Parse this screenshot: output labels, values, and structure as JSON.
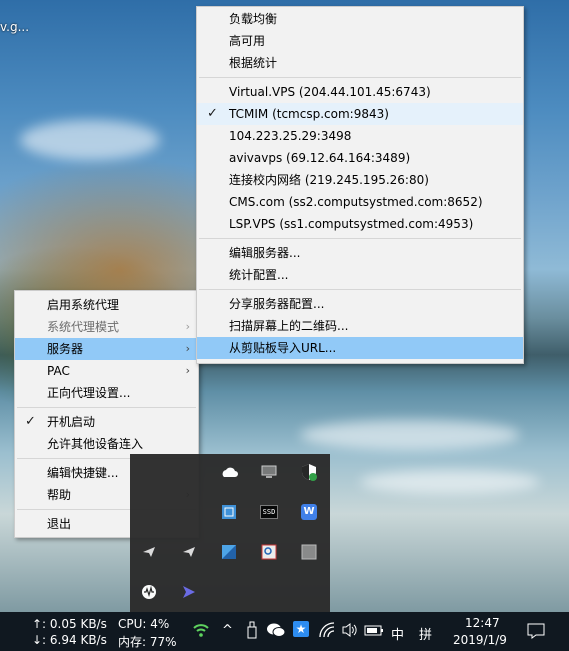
{
  "desktop": {
    "label": "v.g..."
  },
  "main_menu": {
    "items": [
      {
        "label": "启用系统代理",
        "checked": false,
        "submenu": false,
        "disabled": false
      },
      {
        "label": "系统代理模式",
        "checked": false,
        "submenu": true,
        "disabled": true
      },
      {
        "label": "服务器",
        "checked": false,
        "submenu": true,
        "disabled": false,
        "highlighted": true
      },
      {
        "label": "PAC",
        "checked": false,
        "submenu": true,
        "disabled": false
      },
      {
        "label": "正向代理设置...",
        "checked": false,
        "submenu": false,
        "disabled": false
      },
      {
        "label": "开机启动",
        "checked": true,
        "submenu": false,
        "disabled": false
      },
      {
        "label": "允许其他设备连入",
        "checked": false,
        "submenu": false,
        "disabled": false
      },
      {
        "label": "编辑快捷键...",
        "checked": false,
        "submenu": false,
        "disabled": false
      },
      {
        "label": "帮助",
        "checked": false,
        "submenu": true,
        "disabled": false
      },
      {
        "label": "退出",
        "checked": false,
        "submenu": false,
        "disabled": false
      }
    ]
  },
  "server_menu": {
    "items": [
      {
        "label": "负载均衡"
      },
      {
        "label": "高可用"
      },
      {
        "label": "根据统计"
      },
      {
        "label": "Virtual.VPS (204.44.101.45:6743)"
      },
      {
        "label": "TCMIM (tcmcsp.com:9843)",
        "checked": true
      },
      {
        "label": "104.223.25.29:3498"
      },
      {
        "label": "avivavps (69.12.64.164:3489)"
      },
      {
        "label": "连接校内网络 (219.245.195.26:80)"
      },
      {
        "label": "CMS.com (ss2.computsystmed.com:8652)"
      },
      {
        "label": "LSP.VPS (ss1.computsystmed.com:4953)"
      },
      {
        "label": "编辑服务器..."
      },
      {
        "label": "统计配置..."
      },
      {
        "label": "分享服务器配置..."
      },
      {
        "label": "扫描屏幕上的二维码..."
      },
      {
        "label": "从剪贴板导入URL...",
        "highlighted": true
      }
    ]
  },
  "tray_icons": [
    "onedrive-icon",
    "monitor-icon",
    "defender-shield-icon",
    "network-tool-icon",
    "ssd-icon",
    "wps-icon",
    "paper-plane-icon",
    "paper-plane-icon",
    "app-blue-icon",
    "search-box-icon",
    "gray-square-icon",
    "sound-wave-icon",
    "shadowsocks-icon"
  ],
  "tray_text": {
    "ssd": "SSD",
    "wps": "W"
  },
  "taskbar": {
    "upload": "↑: 0.05 KB/s",
    "download": "↓: 6.94 KB/s",
    "cpu": "CPU: 4%",
    "memory": "内存: 77%",
    "ime": "中",
    "ime_mode": "拼",
    "time": "12:47",
    "date": "2019/1/9"
  },
  "colors": {
    "highlight": "#91c9f7",
    "menu_bg": "#f2f2f2",
    "taskbar_bg": "#101820"
  }
}
